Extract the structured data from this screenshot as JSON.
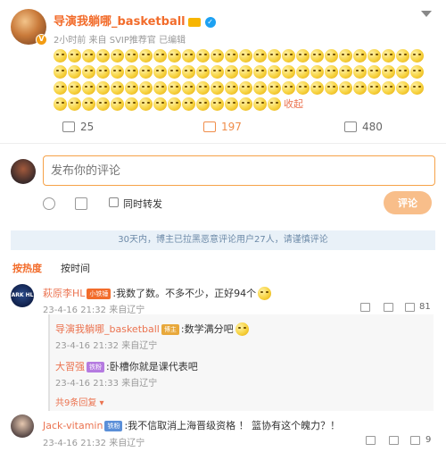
{
  "post": {
    "username": "导演我躺哪_basketball",
    "meta": "2小时前  来自 SVIP推荐官  已编辑",
    "collapse_label": "收起",
    "repost_count": "25",
    "comment_count": "197",
    "like_count": "480"
  },
  "composer": {
    "placeholder": "发布你的评论",
    "repost_label": "同时转发",
    "submit_label": "评论"
  },
  "notice": "30天内，博主已拉黑恶意评论用户27人，请谨慎评论",
  "tabs": {
    "hot": "按热度",
    "time": "按时间"
  },
  "comments": [
    {
      "name": "萩原李HL",
      "badge": "小铁锤",
      "text": ":我数了数。不多不少，正好94个",
      "meta": "23-4-16 21:32  来自辽宁",
      "likes": "81",
      "avatar_text": "ARK HL",
      "replies": [
        {
          "name": "导演我躺哪_basketball",
          "badge": "博主",
          "text": ":数学满分吧",
          "meta": "23-4-16 21:32  来自辽宁"
        },
        {
          "name": "大習强",
          "badge": "铁粉",
          "text": ":卧槽你就是课代表吧",
          "meta": "23-4-16 21:33  来自辽宁"
        }
      ],
      "more_replies": "共9条回复 ▾"
    },
    {
      "name": "Jack-vitamin",
      "badge": "铁粉",
      "text": ":我不信取消上海晋级资格 ！ 篮协有这个魄力？！",
      "meta": "23-4-16 21:32  来自辽宁",
      "likes": "9"
    }
  ],
  "colors": {
    "accent": "#f26c2b",
    "link": "#eb7350",
    "notice_bg": "#e9f1f8"
  },
  "icons": [
    "more-icon",
    "repost-icon",
    "comment-icon",
    "like-icon",
    "emoji-icon",
    "image-icon",
    "share-icon",
    "reply-icon"
  ]
}
